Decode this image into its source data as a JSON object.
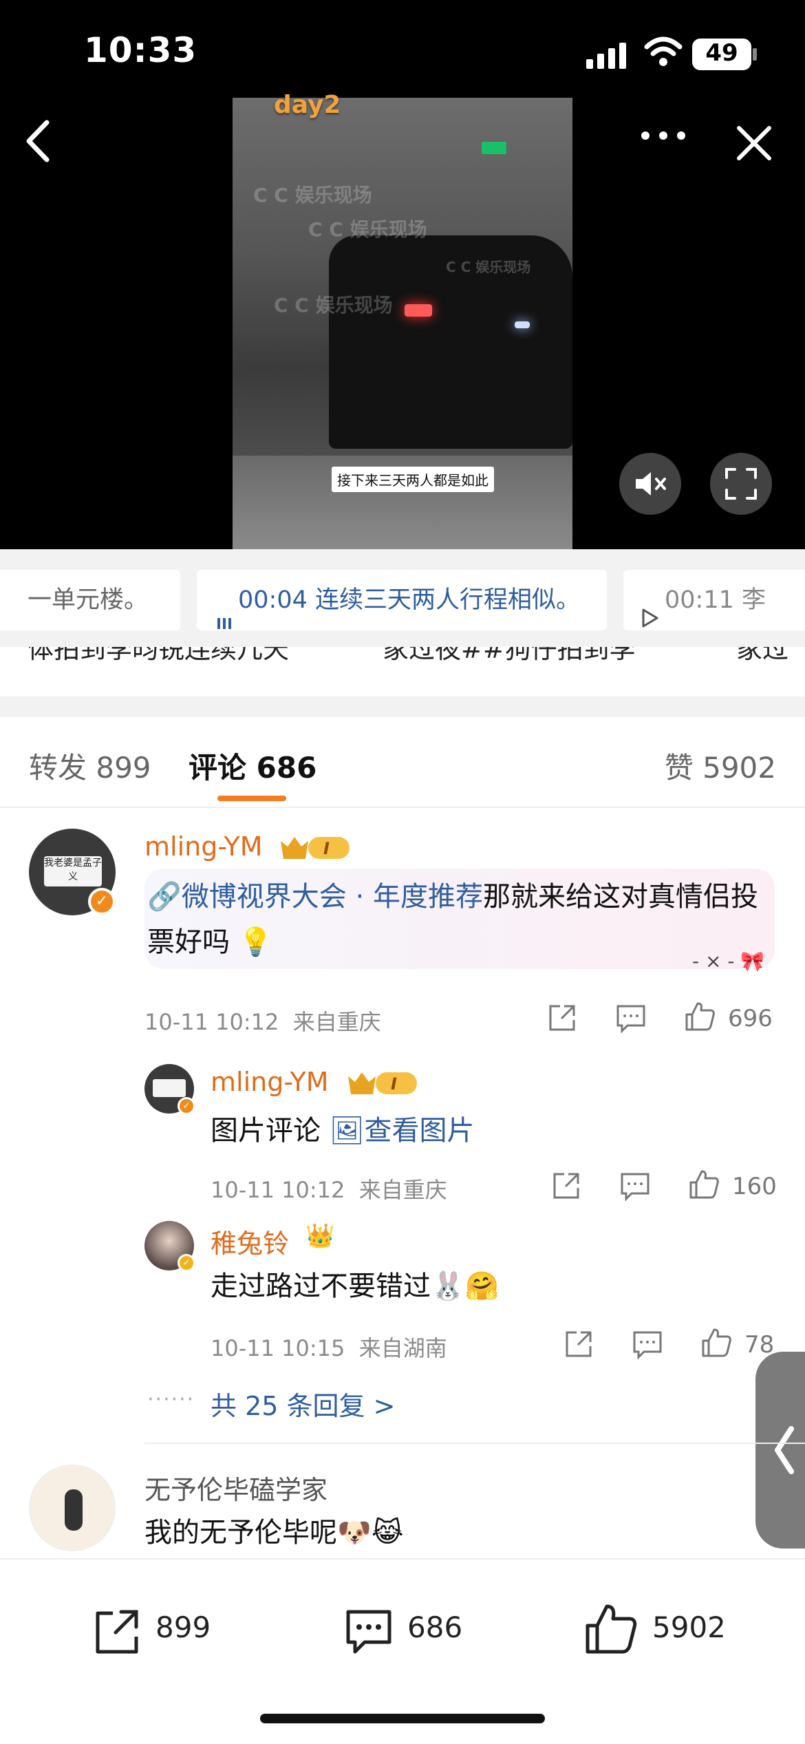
{
  "status_bar": {
    "time": "10:33",
    "battery": "49"
  },
  "video": {
    "overlay_title": "day2",
    "watermark": "C C 娱乐现场",
    "caption": "接下来三天两人都是如此"
  },
  "chapters": [
    {
      "label": "一单元楼。"
    },
    {
      "time": "00:04",
      "label": "连续三天两人行程相似。"
    },
    {
      "time": "00:11",
      "label": "李"
    }
  ],
  "peek_text": [
    "体拍到李昀锐连续几天",
    "家过夜##狗仔拍到李",
    "家过"
  ],
  "tabs": {
    "repost": "转发 899",
    "comment": "评论 686",
    "like": "赞 5902"
  },
  "comments": [
    {
      "username": "mling-YM",
      "topic_link": "微博视界大会 · 年度推荐",
      "text": "那就来给这对真情侣投票好吗",
      "bow_text": "- × -",
      "time": "10-11 10:12",
      "location": "来自重庆",
      "likes": "696"
    }
  ],
  "replies": [
    {
      "username": "mling-YM",
      "text": "图片评论",
      "link": "查看图片",
      "time": "10-11 10:12",
      "location": "来自重庆",
      "likes": "160"
    },
    {
      "username": "稚兔铃",
      "text": "走过路过不要错过",
      "time": "10-11 10:15",
      "location": "来自湖南",
      "likes": "78"
    }
  ],
  "more_replies": "共 25 条回复 >",
  "comment2": {
    "username": "无予伦毕磕学家",
    "text": "我的无予伦毕呢"
  },
  "bottom_bar": {
    "repost": "899",
    "comment": "686",
    "like": "5902"
  },
  "colors": {
    "accent": "#f47b20",
    "username": "#e06c1b",
    "link": "#2f5d9e"
  },
  "avatar_sign_text": "我老婆是孟子义"
}
